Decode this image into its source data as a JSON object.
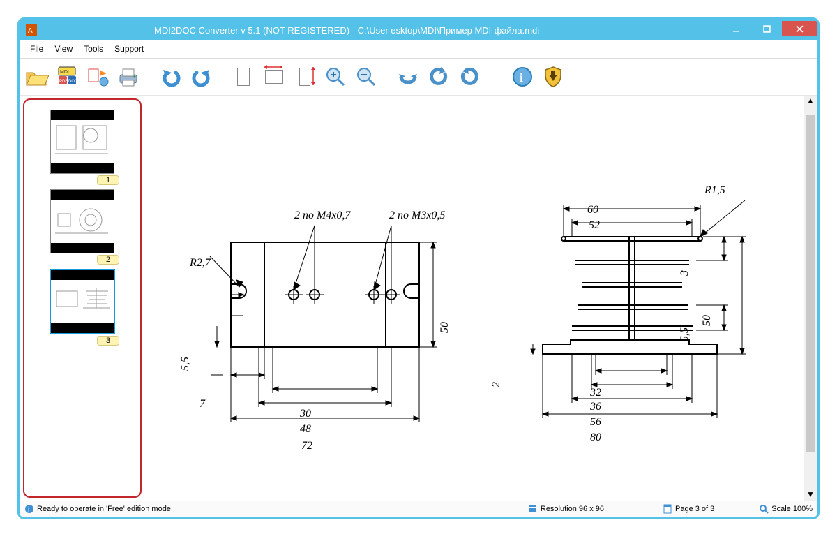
{
  "title": "MDI2DOC Converter v 5.1   (NOT REGISTERED)  -  C:\\User                esktop\\MDI\\Пример MDI-файла.mdi",
  "menu": {
    "file": "File",
    "view": "View",
    "tools": "Tools",
    "support": "Support"
  },
  "thumbs": {
    "p1": "1",
    "p2": "2",
    "p3": "3"
  },
  "labels": {
    "m4": "2 по M4x0,7",
    "m3": "2 по M3x0,5",
    "r27": "R2,7",
    "d55": "5,5",
    "d7": "7",
    "d30": "30",
    "d48": "48",
    "d72": "72",
    "d50": "50",
    "r15": "R1,5",
    "d60": "60",
    "d52": "52",
    "d3": "3",
    "d55b": "5,5",
    "d50b": "50",
    "d2": "2",
    "d32": "32",
    "d36": "36",
    "d56": "56",
    "d80": "80"
  },
  "status": {
    "ready": "Ready to operate in 'Free' edition mode",
    "res": "Resolution 96 x 96",
    "page": "Page 3 of 3",
    "scale": "Scale 100%"
  }
}
